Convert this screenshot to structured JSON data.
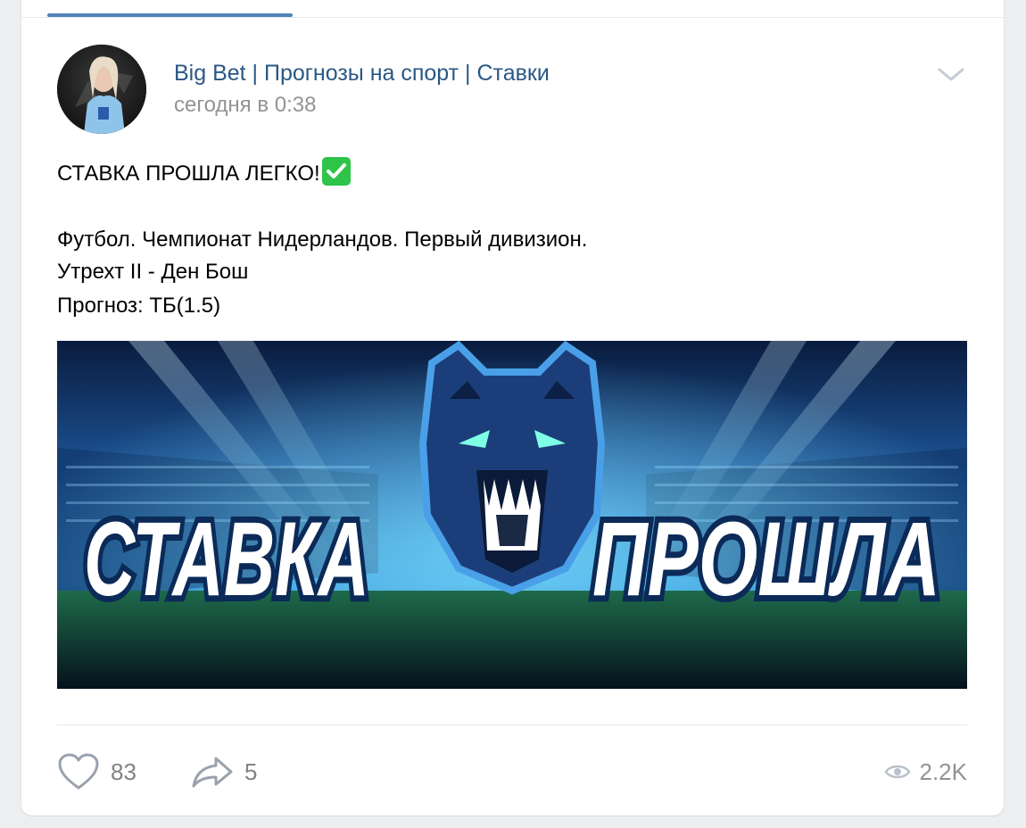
{
  "post": {
    "author": "Big Bet | Прогнозы на спорт | Ставки",
    "time": "сегодня в 0:38",
    "headline": "СТАВКА ПРОШЛА ЛЕГКО!",
    "line1": "Футбол. Чемпионат Нидерландов. Первый дивизион.",
    "line2": "Утрехт II - Ден Бош",
    "line3": "Прогноз: ТБ(1.5)"
  },
  "banner": {
    "left_word": "СТАВКА",
    "right_word": "ПРОШЛА"
  },
  "actions": {
    "likes": "83",
    "shares": "5",
    "views": "2.2K"
  },
  "colors": {
    "link": "#2a5885",
    "accent": "#5181b8",
    "check": "#2ec44a"
  }
}
